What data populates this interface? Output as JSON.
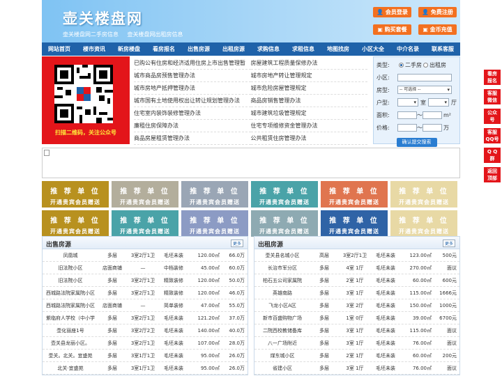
{
  "header": {
    "logo": "壶关楼盘网",
    "slogan": "壶关楼盘网二手房信息 壶关楼盘网出租房信息",
    "buttons": [
      {
        "label": "会员登录"
      },
      {
        "label": "免费注册"
      },
      {
        "label": "购买套餐"
      },
      {
        "label": "金币充值"
      }
    ]
  },
  "nav": [
    "网站首页",
    "楼市资讯",
    "新房楼盘",
    "看房报名",
    "出售房源",
    "出租房源",
    "求购信息",
    "求租信息",
    "地图找房",
    "小区大全",
    "中介名录",
    "联系客服"
  ],
  "qr": {
    "caption": "扫描二维码，关注公众号"
  },
  "links": [
    "已购公有住房和经济适用住房上市出售管理暂",
    "房屋建筑工程质量保修办法",
    "城市商品房预售管理办法",
    "城市房地产转让管理规定",
    "城市房地产抵押管理办法",
    "城市危险房屋管理规定",
    "城市国有土地使用权出让转让规划管理办法",
    "商品房销售管理办法",
    "住宅室内装饰装修管理办法",
    "城市建筑垃圾管理规定",
    "廉租住房保障办法",
    "住宅专项维修资金管理办法",
    "商品房屋租赁管理办法",
    "公共租赁住房管理办法"
  ],
  "search": {
    "type_label": "类型:",
    "opt1": "二手房",
    "opt2": "出租房",
    "community_label": "小区:",
    "house_label": "房型:",
    "select_placeholder": "-- 可选择 --",
    "layout_label": "户型:",
    "room": "室",
    "hall": "厅",
    "area_label": "面积:",
    "price_label": "价格:",
    "tilde": "～",
    "area_unit": "m²",
    "price_unit": "万",
    "submit": "确认提交搜索"
  },
  "ads": {
    "line1": "推 荐 单 位",
    "line2": "开通贵宾会员赠送",
    "colors": [
      "#b8911f",
      "#b3ae9c",
      "#9aa6b5",
      "#4aa3a8",
      "#e0754f",
      "#e8d9a5",
      "#b8911f",
      "#4aa3a8",
      "#8c9bc4",
      "#8eaab2",
      "#2f63a6",
      "#e8d9a5"
    ]
  },
  "sale": {
    "title": "出售房源",
    "more": "更多",
    "rows": [
      [
        "凤凰城",
        "多层",
        "3室2厅1卫",
        "毛坯未装",
        "120.00㎡",
        "66.0万"
      ],
      [
        "旧法院小区",
        "店面商铺",
        "—",
        "中档装修",
        "45.00㎡",
        "60.0万"
      ],
      [
        "旧法院小区",
        "多层",
        "3室2厅1卫",
        "精致装修",
        "120.00㎡",
        "50.0万"
      ],
      [
        "西城路法院家属院小区",
        "多层",
        "3室2厅1卫",
        "精致装修",
        "120.00㎡",
        "46.0万"
      ],
      [
        "西城路法院家属院小区",
        "店面商铺",
        "—",
        "简单装修",
        "47.00㎡",
        "55.0万"
      ],
      [
        "紫临府人学校（中小学",
        "多层",
        "3室2厅1卫",
        "毛坯未装",
        "121.20㎡",
        "37.0万"
      ],
      [
        "壶化丽座1号",
        "多层",
        "3室2厅2卫",
        "毛坯未装",
        "140.00㎡",
        "40.0万"
      ],
      [
        "壶关县龙丽小区。",
        "多层",
        "3室2厅1卫",
        "毛坯未装",
        "107.00㎡",
        "28.0万"
      ],
      [
        "壶关。北关。宜盛苑",
        "多层",
        "3室1厅1卫",
        "毛坯未装",
        "95.00㎡",
        "26.0万"
      ],
      [
        "北关·宜盛苑",
        "多层",
        "3室1厅1卫",
        "毛坯未装",
        "95.00㎡",
        "26.0万"
      ]
    ]
  },
  "rent": {
    "title": "出租房源",
    "more": "更多",
    "rows": [
      [
        "壶关县名城小区",
        "高层",
        "3室2厅1卫",
        "毛坯未装",
        "123.00㎡",
        "500元"
      ],
      [
        "长治市军分区",
        "多层",
        "4室 1厅",
        "毛坯未装",
        "270.00㎡",
        "面议"
      ],
      [
        "柏石五公司家属院",
        "多层",
        "2室 1厅",
        "毛坯未装",
        "60.00㎡",
        "600元"
      ],
      [
        "英雄南路",
        "多层",
        "3室 1厅",
        "毛坯未装",
        "115.00㎡",
        "1666元"
      ],
      [
        "飞龙小区A区",
        "多层",
        "3室 2厅",
        "毛坯未装",
        "150.00㎡",
        "1000元"
      ],
      [
        "新市百盛购物广场",
        "多层",
        "1室 0厅",
        "毛坯未装",
        "39.00㎡",
        "6700元"
      ],
      [
        "二院西校教储备库",
        "多层",
        "3室 1厅",
        "毛坯未装",
        "115.00㎡",
        "面议"
      ],
      [
        "八一广场附近",
        "多层",
        "3室 1厅",
        "毛坯未装",
        "76.00㎡",
        "面议"
      ],
      [
        "煤东城小区",
        "多层",
        "2室 1厅",
        "毛坯未装",
        "60.00㎡",
        "200元"
      ],
      [
        "省建小区",
        "多层",
        "3室 1厅",
        "毛坯未装",
        "76.00㎡",
        "面议"
      ]
    ]
  },
  "side": [
    {
      "l1": "看房",
      "l2": "报名"
    },
    {
      "l1": "客服",
      "l2": "微信"
    },
    {
      "l1": "公众",
      "l2": "号"
    },
    {
      "l1": "客服",
      "l2": "QQ号"
    },
    {
      "l1": "Q Q",
      "l2": "群"
    },
    {
      "l1": "返回",
      "l2": "顶部"
    }
  ]
}
